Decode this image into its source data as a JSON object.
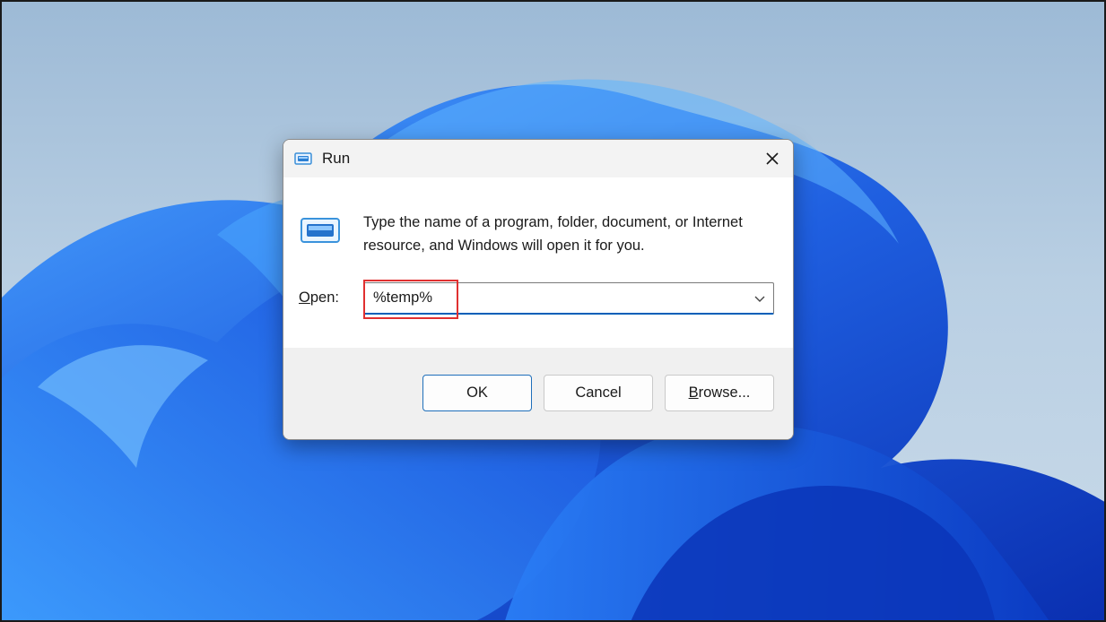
{
  "dialog": {
    "title": "Run",
    "description": "Type the name of a program, folder, document, or Internet resource, and Windows will open it for you.",
    "open_label_mnemonic": "O",
    "open_label_rest": "pen:",
    "open_value": "%temp%",
    "buttons": {
      "ok": "OK",
      "cancel": "Cancel",
      "browse_mnemonic": "B",
      "browse_rest": "rowse..."
    }
  },
  "icons": {
    "title_icon": "run-icon",
    "big_icon": "run-icon",
    "close": "close-icon",
    "dropdown": "chevron-down-icon"
  },
  "colors": {
    "accent": "#005fb8",
    "highlight": "#e03030",
    "wallpaper_blue": "#1f5fe0"
  }
}
